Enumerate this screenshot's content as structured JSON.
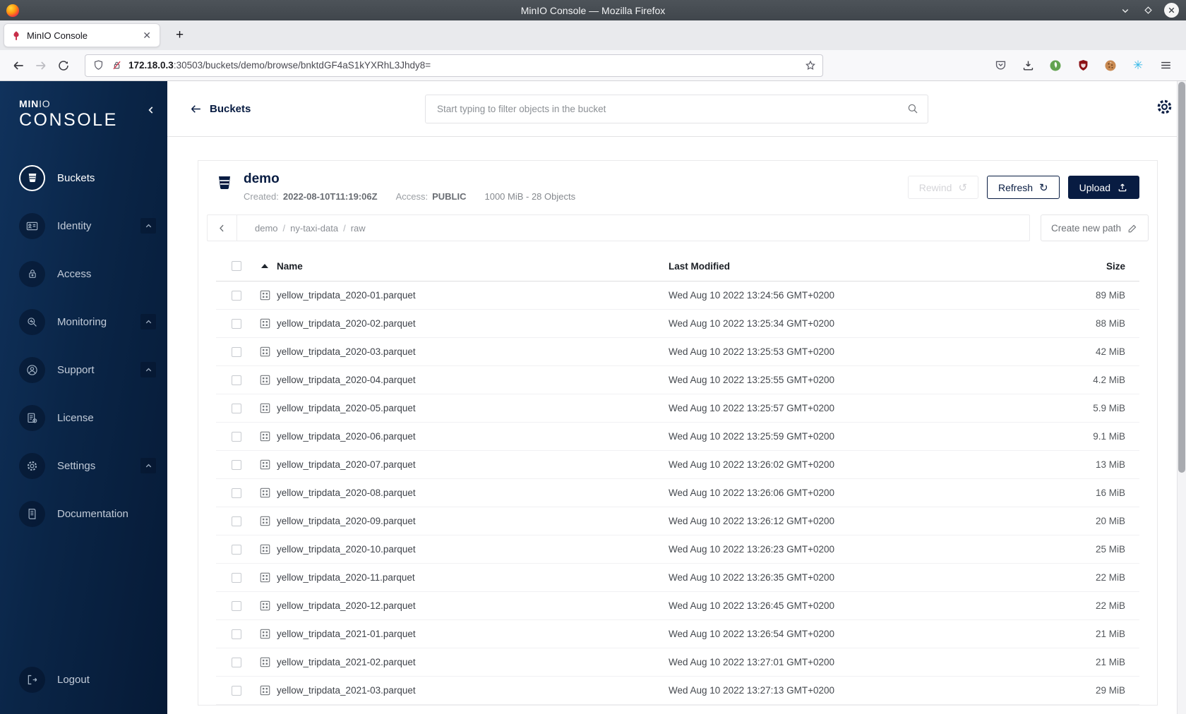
{
  "window": {
    "title": "MinIO Console — Mozilla Firefox"
  },
  "browser": {
    "tab": {
      "title": "MinIO Console",
      "close_glyph": "✕"
    },
    "newtab_glyph": "+",
    "url": {
      "host": "172.18.0.3",
      "rest": ":30503/buckets/demo/browse/bnktdGF4aS1kYXRhL3Jhdy8="
    }
  },
  "sidebar": {
    "brand_bold": "MIN",
    "brand_light": "IO",
    "product": "CONSOLE",
    "items": [
      {
        "label": "Buckets",
        "active": true
      },
      {
        "label": "Identity",
        "expandable": true
      },
      {
        "label": "Access"
      },
      {
        "label": "Monitoring",
        "expandable": true
      },
      {
        "label": "Support",
        "expandable": true
      },
      {
        "label": "License"
      },
      {
        "label": "Settings",
        "expandable": true
      },
      {
        "label": "Documentation"
      }
    ],
    "logout_label": "Logout"
  },
  "header": {
    "back_label": "Buckets",
    "search_placeholder": "Start typing to filter objects in the bucket"
  },
  "bucket": {
    "name": "demo",
    "created_label": "Created:",
    "created": "2022-08-10T11:19:06Z",
    "access_label": "Access:",
    "access": "PUBLIC",
    "summary": "1000 MiB - 28 Objects",
    "actions": {
      "rewind": "Rewind",
      "rewind_glyph": "↺",
      "refresh": "Refresh",
      "refresh_glyph": "↻",
      "upload": "Upload"
    }
  },
  "browse": {
    "path_parts": [
      "demo",
      "ny-taxi-data",
      "raw"
    ],
    "separator": "/",
    "create_button": "Create new path"
  },
  "table": {
    "columns": [
      "Name",
      "Last Modified",
      "Size"
    ],
    "rows": [
      {
        "name": "yellow_tripdata_2020-01.parquet",
        "modified": "Wed Aug 10 2022 13:24:56 GMT+0200",
        "size": "89 MiB"
      },
      {
        "name": "yellow_tripdata_2020-02.parquet",
        "modified": "Wed Aug 10 2022 13:25:34 GMT+0200",
        "size": "88 MiB"
      },
      {
        "name": "yellow_tripdata_2020-03.parquet",
        "modified": "Wed Aug 10 2022 13:25:53 GMT+0200",
        "size": "42 MiB"
      },
      {
        "name": "yellow_tripdata_2020-04.parquet",
        "modified": "Wed Aug 10 2022 13:25:55 GMT+0200",
        "size": "4.2 MiB"
      },
      {
        "name": "yellow_tripdata_2020-05.parquet",
        "modified": "Wed Aug 10 2022 13:25:57 GMT+0200",
        "size": "5.9 MiB"
      },
      {
        "name": "yellow_tripdata_2020-06.parquet",
        "modified": "Wed Aug 10 2022 13:25:59 GMT+0200",
        "size": "9.1 MiB"
      },
      {
        "name": "yellow_tripdata_2020-07.parquet",
        "modified": "Wed Aug 10 2022 13:26:02 GMT+0200",
        "size": "13 MiB"
      },
      {
        "name": "yellow_tripdata_2020-08.parquet",
        "modified": "Wed Aug 10 2022 13:26:06 GMT+0200",
        "size": "16 MiB"
      },
      {
        "name": "yellow_tripdata_2020-09.parquet",
        "modified": "Wed Aug 10 2022 13:26:12 GMT+0200",
        "size": "20 MiB"
      },
      {
        "name": "yellow_tripdata_2020-10.parquet",
        "modified": "Wed Aug 10 2022 13:26:23 GMT+0200",
        "size": "25 MiB"
      },
      {
        "name": "yellow_tripdata_2020-11.parquet",
        "modified": "Wed Aug 10 2022 13:26:35 GMT+0200",
        "size": "22 MiB"
      },
      {
        "name": "yellow_tripdata_2020-12.parquet",
        "modified": "Wed Aug 10 2022 13:26:45 GMT+0200",
        "size": "22 MiB"
      },
      {
        "name": "yellow_tripdata_2021-01.parquet",
        "modified": "Wed Aug 10 2022 13:26:54 GMT+0200",
        "size": "21 MiB"
      },
      {
        "name": "yellow_tripdata_2021-02.parquet",
        "modified": "Wed Aug 10 2022 13:27:01 GMT+0200",
        "size": "21 MiB"
      },
      {
        "name": "yellow_tripdata_2021-03.parquet",
        "modified": "Wed Aug 10 2022 13:27:13 GMT+0200",
        "size": "29 MiB"
      }
    ]
  },
  "colors": {
    "navy": "#081C42",
    "sidebar_top": "#0a2547",
    "accent_red": "#C72E49"
  }
}
